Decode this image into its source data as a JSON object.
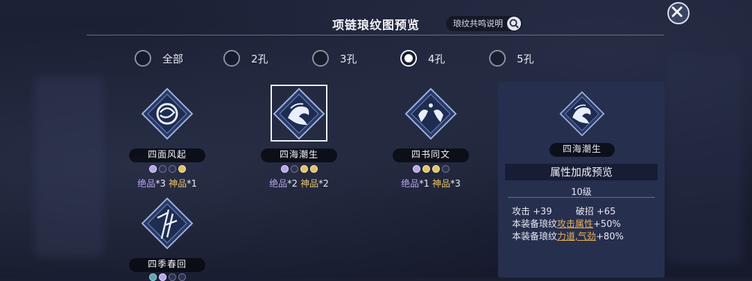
{
  "title": "项链琅纹图预览",
  "help_label": "琅纹共鸣说明",
  "filters": [
    {
      "label": "全部",
      "selected": false
    },
    {
      "label": "2孔",
      "selected": false
    },
    {
      "label": "3孔",
      "selected": false
    },
    {
      "label": "4孔",
      "selected": true
    },
    {
      "label": "5孔",
      "selected": false
    }
  ],
  "items": [
    {
      "name": "四面风起",
      "dots": [
        "purple",
        "empty",
        "empty",
        "gold"
      ],
      "tier1": "绝品",
      "count1": "*3",
      "tier2": "神品",
      "count2": "*1",
      "selected": false
    },
    {
      "name": "四海潮生",
      "dots": [
        "purple",
        "empty",
        "gold",
        "gold"
      ],
      "tier1": "绝品",
      "count1": "*2",
      "tier2": "神品",
      "count2": "*2",
      "selected": true
    },
    {
      "name": "四书同文",
      "dots": [
        "purple",
        "gold",
        "gold",
        "empty"
      ],
      "tier1": "绝品",
      "count1": "*1",
      "tier2": "神品",
      "count2": "*3",
      "selected": false
    },
    {
      "name": "四季春回",
      "dots": [
        "teal",
        "purple",
        "empty",
        "empty"
      ],
      "selected": false
    }
  ],
  "panel": {
    "name": "四海潮生",
    "section_title": "属性加成预览",
    "level": "10级",
    "stats": {
      "attack_label": "攻击",
      "attack_value": "+39",
      "break_label": "破招",
      "break_value": "+65",
      "line1_prefix": "本装备琅纹",
      "line1_highlight": "攻击属性",
      "line1_value": "+50%",
      "line2_prefix": "本装备琅纹",
      "line2_highlight": "力道,气劲",
      "line2_value": "+80%"
    }
  },
  "colors": {
    "accent_gold": "#e8c46a",
    "accent_purple": "#b9a4f2",
    "panel_bg": "#283050"
  }
}
